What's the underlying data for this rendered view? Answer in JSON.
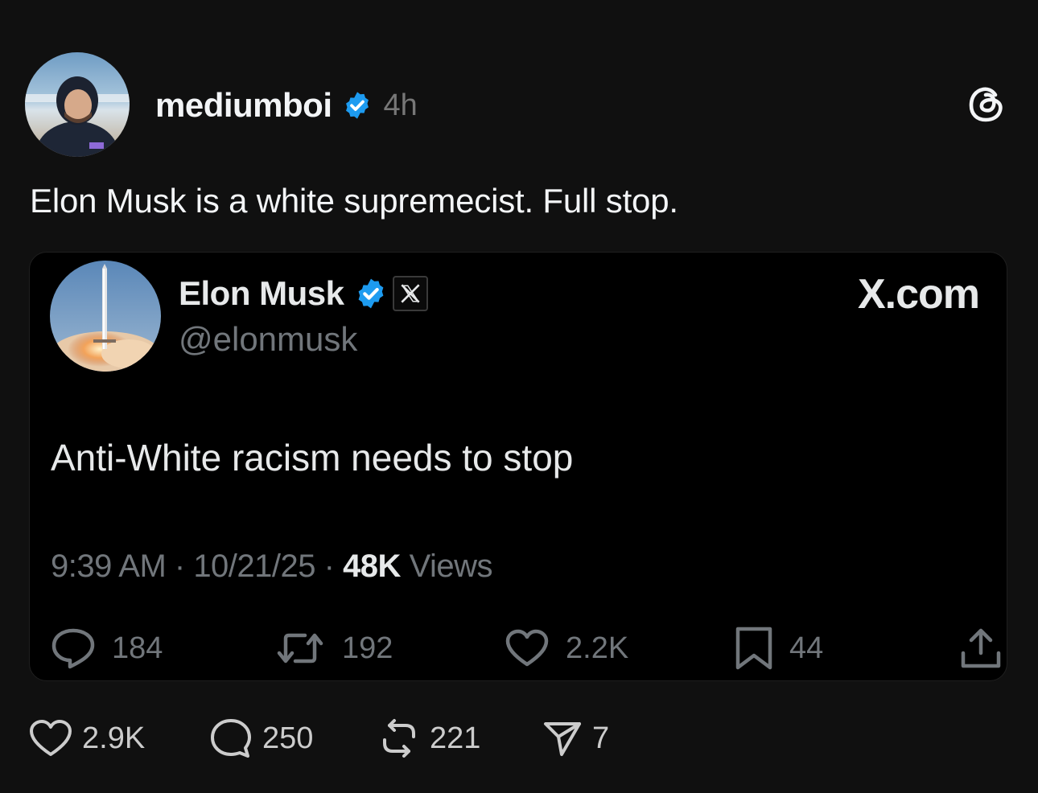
{
  "post": {
    "username": "mediumboi",
    "timestamp": "4h",
    "text": "Elon Musk is a white supremecist. Full stop.",
    "actions": {
      "likes": "2.9K",
      "replies": "250",
      "reposts": "221",
      "shares": "7"
    }
  },
  "embed": {
    "name": "Elon Musk",
    "handle": "@elonmusk",
    "domain": "X.com",
    "text": "Anti-White racism needs to stop",
    "time": "9:39 AM",
    "date": "10/21/25",
    "separator": " · ",
    "views_count": "48K",
    "views_label": " Views",
    "actions": {
      "replies": "184",
      "reposts": "192",
      "likes": "2.2K",
      "bookmarks": "44"
    }
  },
  "colors": {
    "background": "#101010",
    "card_background": "#000000",
    "verified_blue": "#1d9bf0",
    "muted_text": "#71767b"
  },
  "icons": {
    "verified": "verified-badge-icon",
    "threads": "threads-logo-icon",
    "x": "x-logo-icon",
    "reply": "speech-bubble-icon",
    "repost": "repost-icon",
    "like": "heart-icon",
    "bookmark": "bookmark-icon",
    "share": "share-upload-icon",
    "send": "paper-plane-icon"
  }
}
